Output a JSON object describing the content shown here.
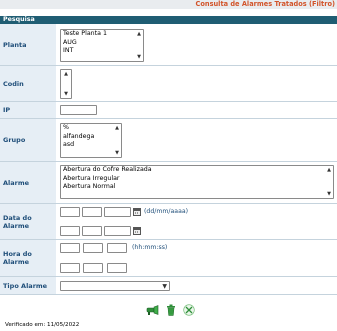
{
  "header": {
    "title": "Consulta de Alarmes Tratados (Filtro)"
  },
  "section": {
    "title": "Pesquisa"
  },
  "fields": {
    "planta": {
      "label": "Planta",
      "options": [
        "Teste Planta 1",
        "AUG",
        "INT"
      ]
    },
    "codin": {
      "label": "Codin",
      "options": []
    },
    "ip": {
      "label": "IP",
      "value": ""
    },
    "grupo": {
      "label": "Grupo",
      "options": [
        "%",
        "alfandega",
        "asd"
      ]
    },
    "alarme": {
      "label": "Alarme",
      "options": [
        "Abertura do Cofre Realizada",
        "Abertura Irregular",
        "Abertura Normal"
      ]
    },
    "data_alarme": {
      "label": "Data do Alarme",
      "hint": "(dd/mm/aaaa)"
    },
    "hora_alarme": {
      "label": "Hora do Alarme",
      "hint": "(hh:mm:ss)"
    },
    "tipo_alarme": {
      "label": "Tipo Alarme",
      "selected": ""
    }
  },
  "actions": [
    {
      "name": "search",
      "icon": "search-flashlight-icon"
    },
    {
      "name": "clear",
      "icon": "trash-icon"
    },
    {
      "name": "excel",
      "icon": "excel-export-icon"
    }
  ],
  "footer": {
    "verified_text": "Verificado em: 11/05/2022"
  },
  "colors": {
    "section_header": "#1f5d73",
    "label_bg": "#e6eef5",
    "label_text": "#1f4e79",
    "title": "#d2542a"
  }
}
